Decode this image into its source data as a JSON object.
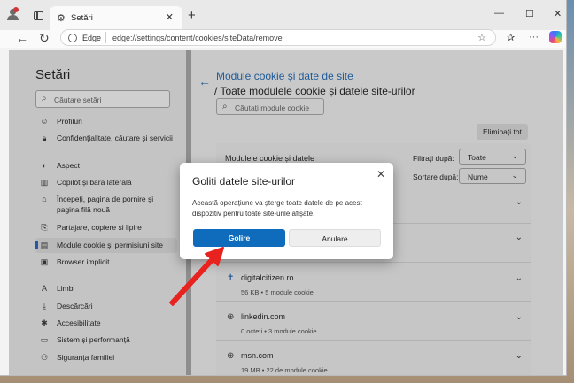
{
  "titlebar": {
    "tab_label": "Setări",
    "tab_close": "✕",
    "new_tab": "+",
    "minimize": "—",
    "maximize": "☐",
    "close": "✕"
  },
  "addressbar": {
    "site_label": "Edge",
    "url": "edge://settings/content/cookies/siteData/remove"
  },
  "sidebar": {
    "title": "Setări",
    "search_placeholder": "Căutare setări",
    "items": [
      {
        "label": "Profiluri",
        "icon": "profile-icon"
      },
      {
        "label": "Confidențialitate, căutare și servicii",
        "icon": "lock-icon"
      },
      {
        "label": "Aspect",
        "icon": "palette-icon"
      },
      {
        "label": "Copilot și bara laterală",
        "icon": "sidebar-icon"
      },
      {
        "label": "Începeți, pagina de pornire și pagina filă nouă",
        "icon": "home-icon"
      },
      {
        "label": "Partajare, copiere și lipire",
        "icon": "share-icon"
      },
      {
        "label": "Module cookie și permisiuni site",
        "icon": "cookie-icon"
      },
      {
        "label": "Browser implicit",
        "icon": "browser-icon"
      },
      {
        "label": "Limbi",
        "icon": "language-icon"
      },
      {
        "label": "Descărcări",
        "icon": "download-icon"
      },
      {
        "label": "Accesibilitate",
        "icon": "accessibility-icon"
      },
      {
        "label": "Sistem și performanță",
        "icon": "performance-icon"
      },
      {
        "label": "Siguranța familiei",
        "icon": "family-icon"
      }
    ]
  },
  "main": {
    "breadcrumb_link": "Module cookie și date de site",
    "title": "/ Toate modulele cookie și datele site-urilor",
    "search_placeholder": "Căutați module cookie",
    "remove_all": "Eliminați tot",
    "list_header": "Modulele cookie și datele",
    "filter_label": "Filtrați după:",
    "filter_value": "Toate",
    "sort_label": "Sortare după:",
    "sort_value": "Nume",
    "sites": [
      {
        "name": "digitalcitizen.ro",
        "meta": "56 KB • 5 module cookie"
      },
      {
        "name": "linkedin.com",
        "meta": "0 octeți • 3 module cookie"
      },
      {
        "name": "msn.com",
        "meta": "19 MB • 22 de module cookie"
      }
    ]
  },
  "dialog": {
    "title": "Goliți datele site-urilor",
    "body": "Această operațiune va șterge toate datele de pe acest dispozitiv pentru toate site-urile afișate.",
    "confirm": "Golire",
    "cancel": "Anulare"
  },
  "colors": {
    "accent": "#0f6cbd",
    "annotation_arrow": "#e8231f"
  }
}
